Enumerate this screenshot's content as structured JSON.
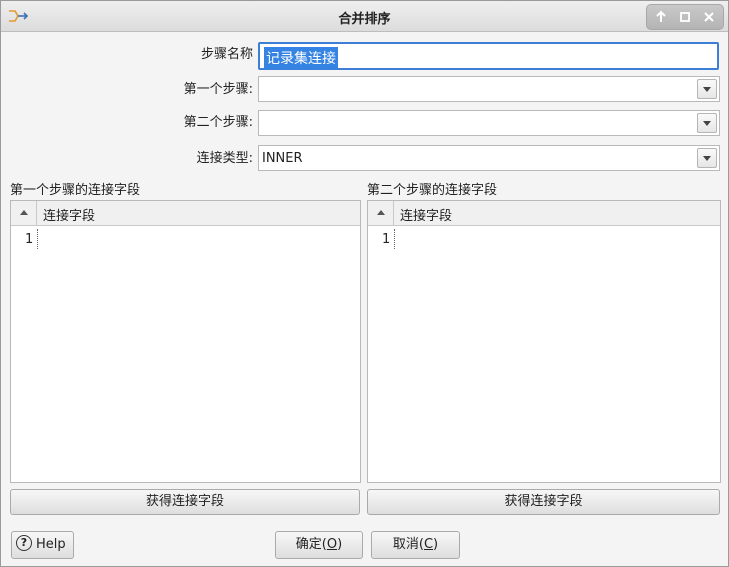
{
  "window": {
    "title": "合并排序",
    "icons": {
      "app": "merge-step-icon",
      "up": "arrow-up-icon",
      "maximize": "maximize-icon",
      "close": "close-icon"
    }
  },
  "form": {
    "step_name_label": "步骤名称",
    "step_name_value": "记录集连接",
    "first_step_label": "第一个步骤:",
    "first_step_value": "",
    "second_step_label": "第二个步骤:",
    "second_step_value": "",
    "join_type_label": "连接类型:",
    "join_type_value": "INNER"
  },
  "left_panel": {
    "title": "第一个步骤的连接字段",
    "column_header": "连接字段",
    "rows": [
      "1"
    ],
    "button": "获得连接字段"
  },
  "right_panel": {
    "title": "第二个步骤的连接字段",
    "column_header": "连接字段",
    "rows": [
      "1"
    ],
    "button": "获得连接字段"
  },
  "footer": {
    "help": "Help",
    "ok_main": "确定(",
    "ok_key": "O",
    "ok_end": ")",
    "cancel_main": "取消(",
    "cancel_key": "C",
    "cancel_end": ")"
  },
  "colors": {
    "selection": "#3584e4",
    "focus_border": "#3d7ed6"
  }
}
